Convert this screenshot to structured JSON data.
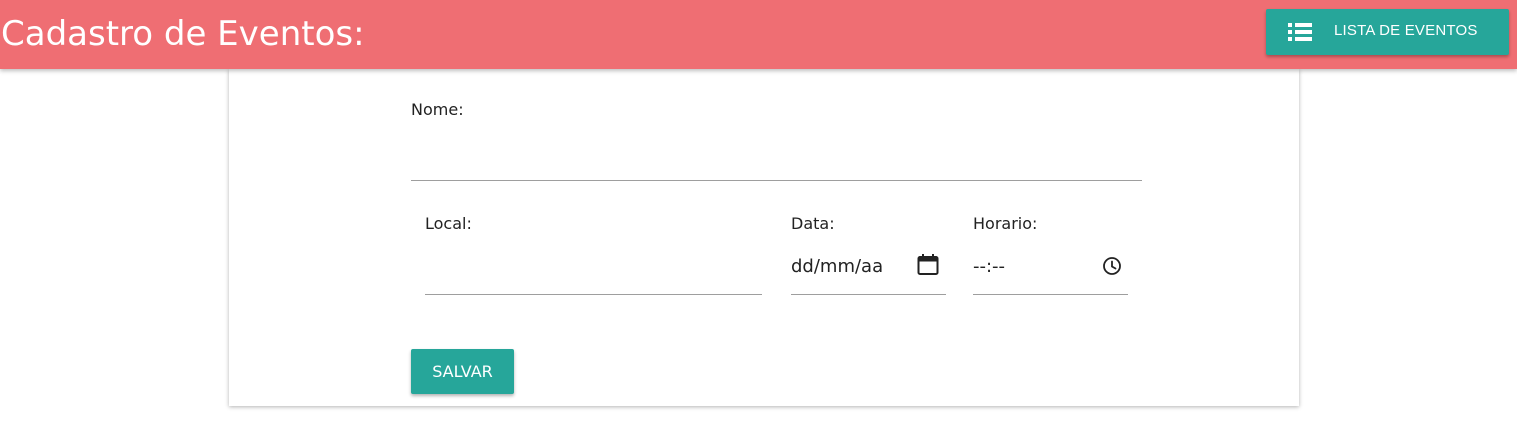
{
  "header": {
    "title": "Cadastro de Eventos:",
    "background_color": "#ef6e73",
    "list_button": {
      "label": "LISTA DE EVENTOS",
      "icon": "list-icon",
      "color": "#26a69a"
    }
  },
  "form": {
    "nome": {
      "label": "Nome:",
      "value": ""
    },
    "local": {
      "label": "Local:",
      "value": ""
    },
    "data": {
      "label": "Data:",
      "placeholder": "dd/mm/aa",
      "icon": "calendar-icon"
    },
    "horario": {
      "label": "Horario:",
      "placeholder": "--:--",
      "icon": "clock-icon"
    },
    "save_button": {
      "label": "SALVAR",
      "color": "#26a69a"
    }
  }
}
